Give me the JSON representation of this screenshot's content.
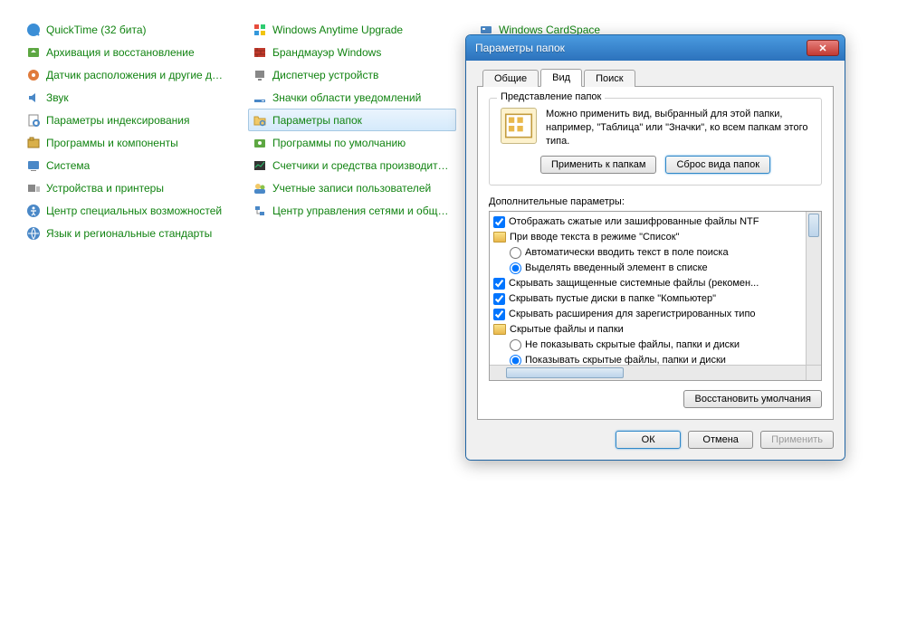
{
  "cols": [
    [
      {
        "label": "QuickTime (32 бита)",
        "icon": "qt"
      },
      {
        "label": "Архивация и восстановление",
        "icon": "backup"
      },
      {
        "label": "Датчик расположения и другие дат...",
        "icon": "sensor"
      },
      {
        "label": "Звук",
        "icon": "sound"
      },
      {
        "label": "Параметры индексирования",
        "icon": "index"
      },
      {
        "label": "Программы и компоненты",
        "icon": "programs"
      },
      {
        "label": "Система",
        "icon": "system"
      },
      {
        "label": "Устройства и принтеры",
        "icon": "devices"
      },
      {
        "label": "Центр специальных возможностей",
        "icon": "access"
      },
      {
        "label": "Язык и региональные стандарты",
        "icon": "region"
      }
    ],
    [
      {
        "label": "Windows Anytime Upgrade",
        "icon": "upgrade"
      },
      {
        "label": "Брандмауэр Windows",
        "icon": "firewall"
      },
      {
        "label": "Диспетчер устройств",
        "icon": "devmgr"
      },
      {
        "label": "Значки области уведомлений",
        "icon": "notify"
      },
      {
        "label": "Параметры папок",
        "icon": "folderopt",
        "selected": true
      },
      {
        "label": "Программы по умолчанию",
        "icon": "defprog"
      },
      {
        "label": "Счетчики и средства производител...",
        "icon": "perf"
      },
      {
        "label": "Учетные записи пользователей",
        "icon": "users"
      },
      {
        "label": "Центр управления сетями и общи...",
        "icon": "network"
      }
    ],
    [
      {
        "label": "Windows CardSpace",
        "icon": "cardspace"
      }
    ]
  ],
  "dialog": {
    "title": "Параметры папок",
    "tabs": [
      "Общие",
      "Вид",
      "Поиск"
    ],
    "active_tab": 1,
    "group_title": "Представление папок",
    "group_text": "Можно применить вид, выбранный для этой папки, например, \"Таблица\" или \"Значки\", ко всем папкам этого типа.",
    "btn_apply_folders": "Применить к папкам",
    "btn_reset_folders": "Сброс вида папок",
    "adv_label": "Дополнительные параметры:",
    "tree": [
      {
        "type": "chk",
        "checked": true,
        "indent": 0,
        "label": "Отображать сжатые или зашифрованные файлы NTF"
      },
      {
        "type": "folder",
        "indent": 0,
        "label": "При вводе текста в режиме \"Список\""
      },
      {
        "type": "rad",
        "checked": false,
        "indent": 1,
        "label": "Автоматически вводить текст в поле поиска"
      },
      {
        "type": "rad",
        "checked": true,
        "indent": 1,
        "label": "Выделять введенный элемент в списке"
      },
      {
        "type": "chk",
        "checked": true,
        "indent": 0,
        "label": "Скрывать защищенные системные файлы (рекомен..."
      },
      {
        "type": "chk",
        "checked": true,
        "indent": 0,
        "label": "Скрывать пустые диски в папке \"Компьютер\""
      },
      {
        "type": "chk",
        "checked": true,
        "indent": 0,
        "label": "Скрывать расширения для зарегистрированных типо"
      },
      {
        "type": "folder",
        "indent": 0,
        "label": "Скрытые файлы и папки"
      },
      {
        "type": "rad",
        "checked": false,
        "indent": 1,
        "label": "Не показывать скрытые файлы, папки и диски"
      },
      {
        "type": "rad",
        "checked": true,
        "indent": 1,
        "label": "Показывать скрытые файлы, папки и диски"
      }
    ],
    "btn_restore": "Восстановить умолчания",
    "btn_ok": "ОК",
    "btn_cancel": "Отмена",
    "btn_apply": "Применить"
  }
}
